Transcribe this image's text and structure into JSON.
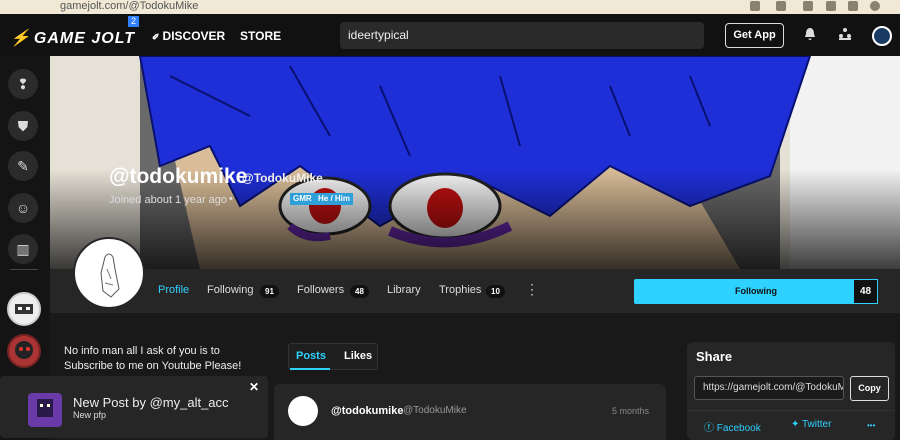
{
  "browser": {
    "url": "gamejolt.com/@TodokuMike"
  },
  "header": {
    "logo": "GAME JOLT",
    "logo_badge": "2",
    "nav_discover": "DISCOVER",
    "nav_store": "STORE",
    "search_value": "ideertypical",
    "get_app": "Get App"
  },
  "profile": {
    "username": "@todokumike",
    "handle": "@TodokuMike",
    "joined": "Joined about 1 year ago",
    "dot": "•",
    "tags": [
      "GMR",
      "He / Him"
    ],
    "tabs": [
      {
        "label": "Profile"
      },
      {
        "label": "Following",
        "count": "91"
      },
      {
        "label": "Followers",
        "count": "48"
      },
      {
        "label": "Library"
      },
      {
        "label": "Trophies",
        "count": "10"
      }
    ],
    "follow_label": "Following",
    "follow_count": "48",
    "more": "⋮"
  },
  "bio": "No info man all I ask of you is to Subscribe to me on Youtube Please!",
  "content_tabs": [
    "Posts",
    "Likes"
  ],
  "post": {
    "user": "@todokumike",
    "handle": "@TodokuMike",
    "time": "5 months"
  },
  "share": {
    "title": "Share",
    "url": "https://gamejolt.com/@TodokuMike",
    "copy": "Copy",
    "facebook": "Facebook",
    "twitter": "Twitter",
    "more": "•••"
  },
  "toast": {
    "title": "New Post by @my_alt_acc",
    "subtitle": "New pfp",
    "close": "✕"
  },
  "colors": {
    "accent": "#2fd1ff",
    "tag": "#2f9fd8",
    "hair": "#1f2fd8"
  }
}
